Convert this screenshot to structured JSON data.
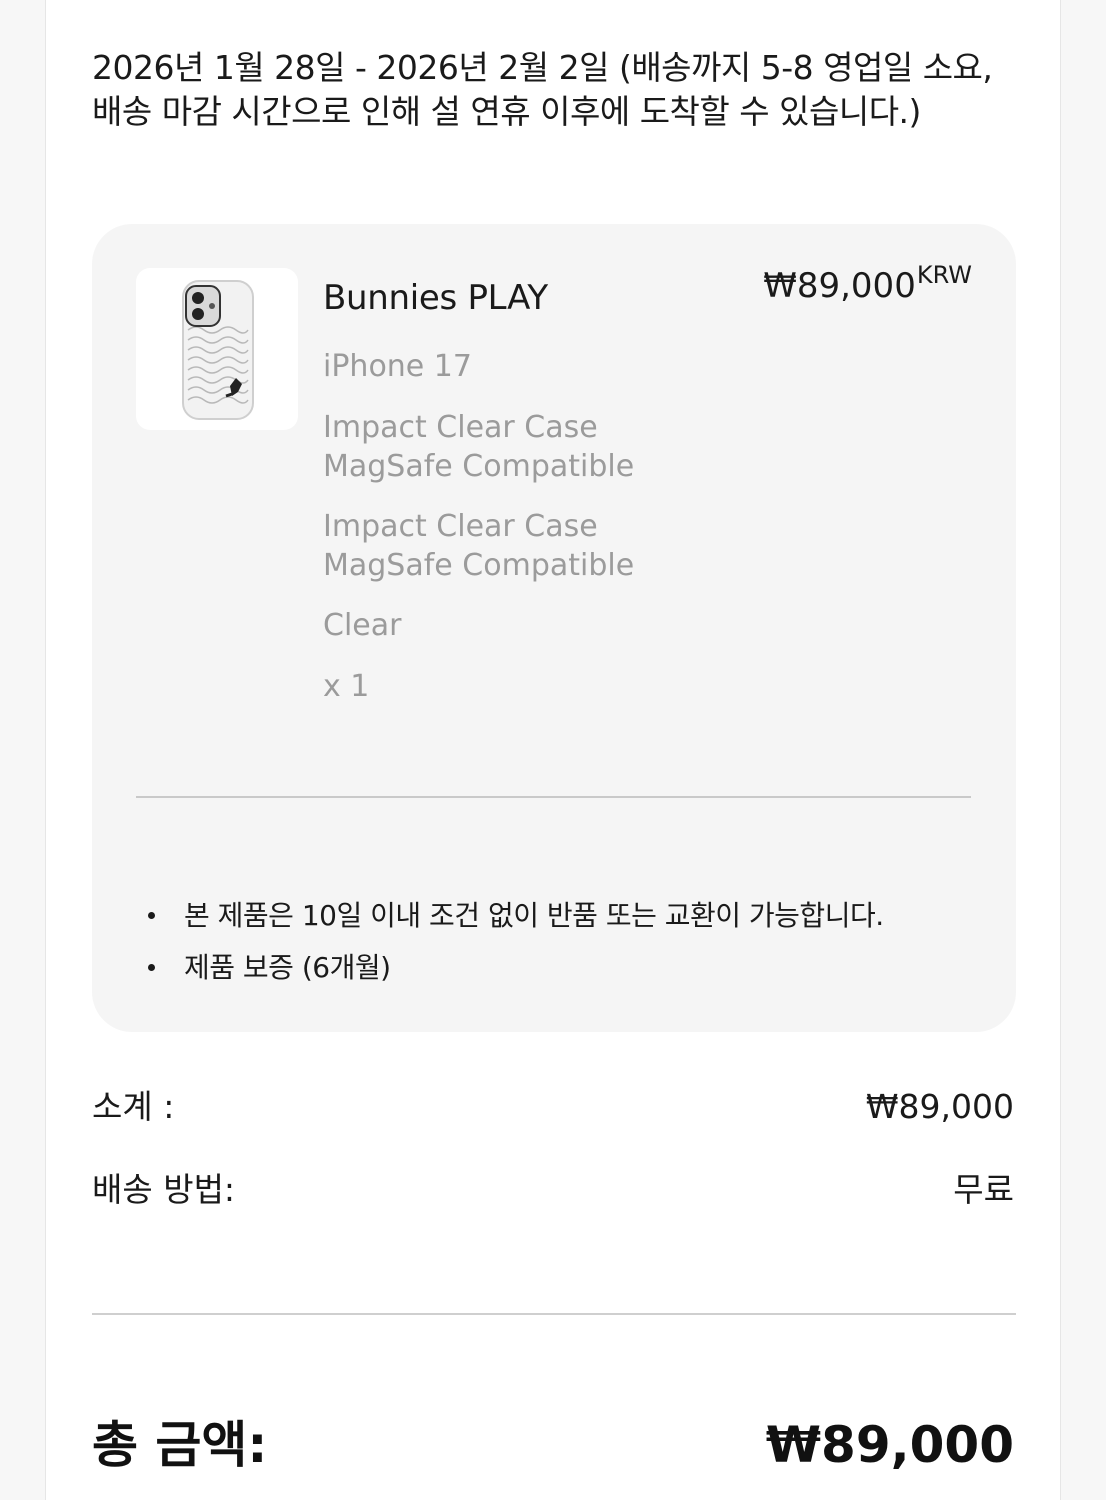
{
  "delivery_text": "2026년 1월 28일 - 2026년 2월 2일 (배송까지 5-8 영업일 소요, 배송 마감 시간으로 인해 설 연휴 이후에 도착할 수 있습니다.)",
  "item": {
    "name": "Bunnies PLAY",
    "price": "₩89,000",
    "currency": "KRW",
    "device": "iPhone 17",
    "case_type_1": "Impact Clear Case MagSafe Compatible",
    "case_type_2": "Impact Clear Case MagSafe Compatible",
    "color": "Clear",
    "quantity": "x 1",
    "thumbnail_icon": "phone-case-icon"
  },
  "notes": [
    "본 제품은 10일 이내 조건 없이 반품 또는 교환이 가능합니다.",
    "제품 보증 (6개월)"
  ],
  "summary": {
    "subtotal_label": "소계 :",
    "subtotal_value": "₩89,000",
    "shipping_label": "배송 방법:",
    "shipping_value": "무료"
  },
  "total": {
    "label": "총 금액:",
    "value": "₩89,000"
  }
}
